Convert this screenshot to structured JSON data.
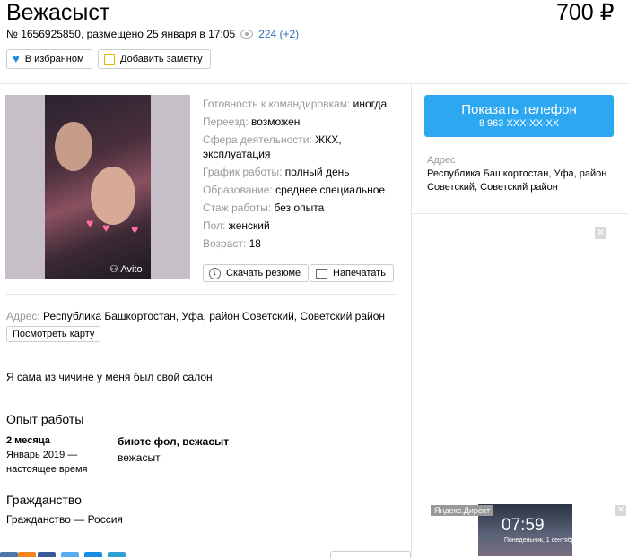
{
  "listing": {
    "title": "Вежасыст",
    "price": "700 ₽",
    "number_text": "№ 1656925850, размещено 25 января в 17:05",
    "views": "224 (+2)"
  },
  "actions": {
    "favorite_label": "В избранном",
    "note_label": "Добавить заметку",
    "download_label": "Скачать резюме",
    "print_label": "Напечатать",
    "map_label": "Посмотреть карту"
  },
  "photo": {
    "watermark": "Avito",
    "icon": "camera-icon"
  },
  "params": [
    {
      "label": "Готовность к командировкам:",
      "value": "иногда"
    },
    {
      "label": "Переезд:",
      "value": "возможен"
    },
    {
      "label": "Сфера деятельности:",
      "value": "ЖКХ, эксплуатация"
    },
    {
      "label": "График работы:",
      "value": "полный день"
    },
    {
      "label": "Образование:",
      "value": "среднее специальное"
    },
    {
      "label": "Стаж работы:",
      "value": "без опыта"
    },
    {
      "label": "Пол:",
      "value": "женский"
    },
    {
      "label": "Возраст:",
      "value": "18"
    }
  ],
  "address": {
    "label": "Адрес:",
    "value": "Республика Башкортостан, Уфа, район Советский, Советский район"
  },
  "description": "Я сама из чичине у меня был свой салон",
  "experience": {
    "heading": "Опыт работы",
    "duration": "2 месяца",
    "period_line1": "Январь 2019 —",
    "period_line2": "настоящее время",
    "company": "биюте фол, вежасыт",
    "position": "вежасыт"
  },
  "citizenship": {
    "heading": "Гражданство",
    "value": "Гражданство — Россия"
  },
  "sidebar": {
    "phone_label": "Показать телефон",
    "phone_number": "8 963 XXX-XX-XX",
    "address_label": "Адрес",
    "address_line1": "Республика Башкортостан, Уфа, район",
    "address_line2": "Советский, Советский район"
  },
  "ad": {
    "label": "Яндекс.Директ",
    "time": "07:59",
    "date": "Понедельник, 1 сентября"
  },
  "colors": {
    "accent": "#2da8f0",
    "link": "#2f6fb3",
    "muted": "#999999"
  }
}
